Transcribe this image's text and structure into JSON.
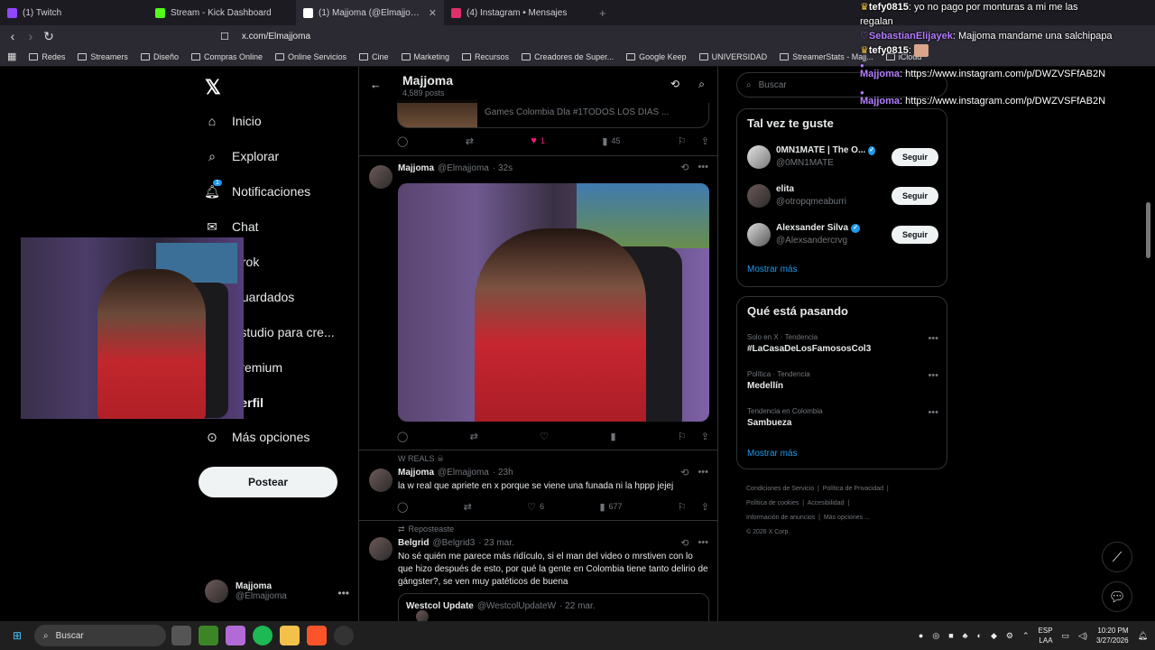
{
  "browser": {
    "tabs": [
      {
        "label": "(1) Twitch",
        "color": "#9146ff"
      },
      {
        "label": "Stream - Kick Dashboard",
        "color": "#53fc18"
      },
      {
        "label": "(1) Majjoma (@Elmajjoma) / X",
        "color": "#ffffff"
      },
      {
        "label": "(4) Instagram • Mensajes",
        "color": "#e1306c"
      }
    ],
    "url": "x.com/Elmajjoma",
    "bookmarks": [
      "Redes",
      "Streamers",
      "Diseño",
      "Compras Online",
      "Online Servicios",
      "Cine",
      "Marketing",
      "Recursos",
      "Creadores de Super...",
      "Google Keep",
      "UNIVERSIDAD",
      "StreamerStats - Majj...",
      "iCloud"
    ]
  },
  "chat": [
    {
      "user": "tefy0815",
      "user_color": "#ffffff",
      "text": "yo no pago por monturas a mi me las regalan"
    },
    {
      "user": "SebastianElijayek",
      "user_color": "#b47cff",
      "text": "Majjoma mandame una salchipapa"
    },
    {
      "user": "tefy0815",
      "user_color": "#ffffff",
      "text": ""
    },
    {
      "user": "Majjoma",
      "user_color": "#b47cff",
      "text": "https://www.instagram.com/p/DWZVSFfAB2N"
    },
    {
      "user": "Majjoma",
      "user_color": "#b47cff",
      "text": "https://www.instagram.com/p/DWZVSFfAB2N"
    }
  ],
  "sidebar": {
    "items": [
      {
        "label": "Inicio",
        "icon": "home-icon"
      },
      {
        "label": "Explorar",
        "icon": "search-icon"
      },
      {
        "label": "Notificaciones",
        "icon": "bell-icon",
        "badge": "1"
      },
      {
        "label": "Chat",
        "icon": "mail-icon"
      },
      {
        "label": "Grok",
        "icon": "grok-icon"
      },
      {
        "label": "Guardados",
        "icon": "bookmark-icon"
      },
      {
        "label": "Estudio para cre...",
        "icon": "studio-icon"
      },
      {
        "label": "Premium",
        "icon": "premium-icon"
      },
      {
        "label": "Perfil",
        "icon": "profile-icon"
      },
      {
        "label": "Más opciones",
        "icon": "more-icon"
      }
    ],
    "post_label": "Postear",
    "account": {
      "name": "Majjoma",
      "handle": "@Elmajjoma"
    }
  },
  "feed": {
    "header": {
      "name": "Majjoma",
      "count": "4,589 posts"
    },
    "quote_preview_text": "Games Colombia Dla #1TODOS LOS DIAS ...",
    "top_actions": {
      "likes": "1",
      "views": "45"
    },
    "tweets": [
      {
        "name": "Majjoma",
        "handle": "@Elmajjoma",
        "time": "· 32s"
      },
      {
        "pin_label": "W REALS ☠",
        "name": "Majjoma",
        "handle": "@Elmajjoma",
        "time": "· 23h",
        "text": "la w real que apriete en x porque se viene una funada ni la hppp jejej",
        "likes": "6",
        "views": "677"
      },
      {
        "repost_label": "Reposteaste",
        "name": "Belgrid",
        "handle": "@Belgrid3",
        "time": "· 23 mar.",
        "text": "No sé quién me parece más ridículo, si el man del video o mrstiven con lo que hizo después de esto, por qué la gente en Colombia tiene tanto delirio de gángster?, se ven muy patéticos de buena",
        "quote": {
          "name": "Westcol Update",
          "handle": "@WestcolUpdateW",
          "time": "· 22 mar."
        }
      }
    ]
  },
  "right": {
    "search_placeholder": "Buscar",
    "suggestions_title": "Tal vez te guste",
    "suggestions": [
      {
        "name": "0MN1MATE | The O...",
        "handle": "@0MN1MATE",
        "verified": true
      },
      {
        "name": "elita",
        "handle": "@otropqmeaburri",
        "verified": false
      },
      {
        "name": "Alexsander Silva",
        "handle": "@Alexsandercrvg",
        "verified": true
      }
    ],
    "follow_label": "Seguir",
    "show_more": "Mostrar más",
    "trends_title": "Qué está pasando",
    "trends": [
      {
        "context": "Solo en X · Tendencia",
        "title": "#LaCasaDeLosFamososCol3"
      },
      {
        "context": "Política · Tendencia",
        "title": "Medellín"
      },
      {
        "context": "Tendencia en Colombia",
        "title": "Sambueza"
      }
    ],
    "footer": [
      "Condiciones de Servicio",
      "Política de Privacidad",
      "Política de cookies",
      "Accesibilidad",
      "Información de anuncios",
      "Más opciones ...",
      "© 2026 X Corp."
    ]
  },
  "taskbar": {
    "search": "Buscar",
    "lang": "ESP",
    "lang2": "LAA",
    "time": "10:20 PM",
    "date": "3/27/2026"
  }
}
